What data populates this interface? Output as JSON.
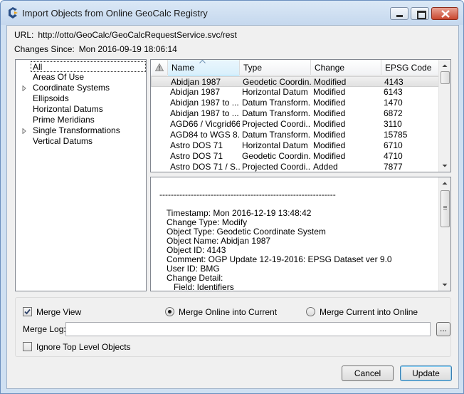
{
  "window": {
    "title": "Import Objects from Online GeoCalc Registry"
  },
  "info": {
    "url_label": "URL:",
    "url_value": "http://otto/GeoCalc/GeoCalcRequestService.svc/rest",
    "changes_label": "Changes Since:",
    "changes_value": "Mon 2016-09-19 18:06:14"
  },
  "tree": {
    "items": [
      {
        "label": "All",
        "expandable": false,
        "selected": true
      },
      {
        "label": "Areas Of Use",
        "expandable": false
      },
      {
        "label": "Coordinate Systems",
        "expandable": true
      },
      {
        "label": "Ellipsoids",
        "expandable": false
      },
      {
        "label": "Horizontal Datums",
        "expandable": false
      },
      {
        "label": "Prime Meridians",
        "expandable": false
      },
      {
        "label": "Single Transformations",
        "expandable": true
      },
      {
        "label": "Vertical Datums",
        "expandable": false
      }
    ]
  },
  "grid": {
    "columns": [
      "Name",
      "Type",
      "Change",
      "EPSG Code"
    ],
    "rows": [
      {
        "name": "Abidjan 1987",
        "type": "Geodetic Coordin...",
        "change": "Modified",
        "code": "4143"
      },
      {
        "name": "Abidjan 1987",
        "type": "Horizontal Datum",
        "change": "Modified",
        "code": "6143"
      },
      {
        "name": "Abidjan 1987 to ...",
        "type": "Datum Transform...",
        "change": "Modified",
        "code": "1470"
      },
      {
        "name": "Abidjan 1987 to ...",
        "type": "Datum Transform...",
        "change": "Modified",
        "code": "6872"
      },
      {
        "name": "AGD66 / Vicgrid66",
        "type": "Projected Coordi...",
        "change": "Modified",
        "code": "3110"
      },
      {
        "name": "AGD84 to WGS 8...",
        "type": "Datum Transform...",
        "change": "Modified",
        "code": "15785"
      },
      {
        "name": "Astro DOS 71",
        "type": "Horizontal Datum",
        "change": "Modified",
        "code": "6710"
      },
      {
        "name": "Astro DOS 71",
        "type": "Geodetic Coordin...",
        "change": "Modified",
        "code": "4710"
      },
      {
        "name": "Astro DOS 71 / S...",
        "type": "Projected Coordi...",
        "change": "Added",
        "code": "7877"
      }
    ]
  },
  "detail": {
    "lines": [
      "--------------------------------------------------------------",
      "",
      "   Timestamp: Mon 2016-12-19 13:48:42",
      "   Change Type: Modify",
      "   Object Type: Geodetic Coordinate System",
      "   Object Name: Abidjan 1987",
      "   Object ID: 4143",
      "   Comment: OGP Update 12-19-2016: EPSG Dataset ver 9.0",
      "   User ID: BMG",
      "   Change Detail:",
      "      Field: Identifiers"
    ]
  },
  "options": {
    "merge_view_label": "Merge View",
    "merge_online_label": "Merge Online into Current",
    "merge_current_label": "Merge Current into Online",
    "merge_log_label": "Merge Log:",
    "merge_log_value": "",
    "browse_label": "...",
    "ignore_top_label": "Ignore Top Level Objects"
  },
  "buttons": {
    "cancel": "Cancel",
    "update": "Update"
  }
}
